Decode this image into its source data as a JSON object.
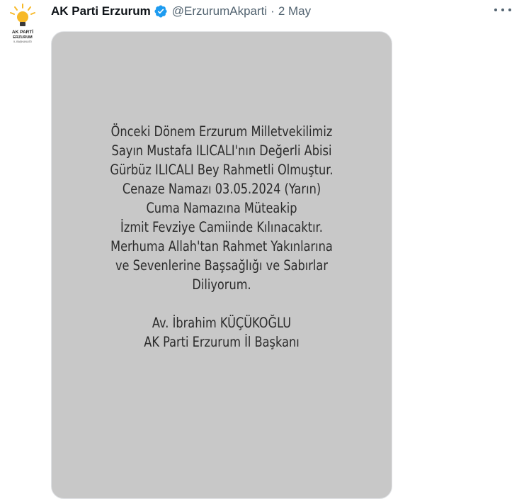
{
  "tweet": {
    "author_name": "AK Parti Erzurum",
    "handle": "@ErzurumAkparti",
    "separator": "·",
    "date": "2 May",
    "avatar_text": [
      "AK PARTİ",
      "ERZURUM",
      "İL BAŞKANLIĞI"
    ]
  },
  "icons": {
    "avatar": "akparti-bulb-logo-icon",
    "verified": "verified-badge-icon",
    "more": "more-options-icon"
  },
  "colors": {
    "verified_badge": "#1d9bf0",
    "media_background": "#c8c8c8",
    "logo_yellow": "#f7b928"
  },
  "notice": {
    "message_lines": [
      "Önceki Dönem Erzurum Milletvekilimiz",
      "Sayın Mustafa ILICALI'nın Değerli Abisi",
      "Gürbüz ILICALI Bey Rahmetli Olmuştur.",
      "Cenaze Namazı 03.05.2024 (Yarın)",
      "Cuma Namazına Müteakip",
      "İzmit Fevziye Camiinde Kılınacaktır.",
      "Merhuma Allah'tan Rahmet Yakınlarına",
      "ve Sevenlerine Başsağlığı ve Sabırlar",
      "Diliyorum."
    ],
    "signature_name": "Av. İbrahim KÜÇÜKOĞLU",
    "signature_title": "AK Parti Erzurum İl Başkanı"
  }
}
